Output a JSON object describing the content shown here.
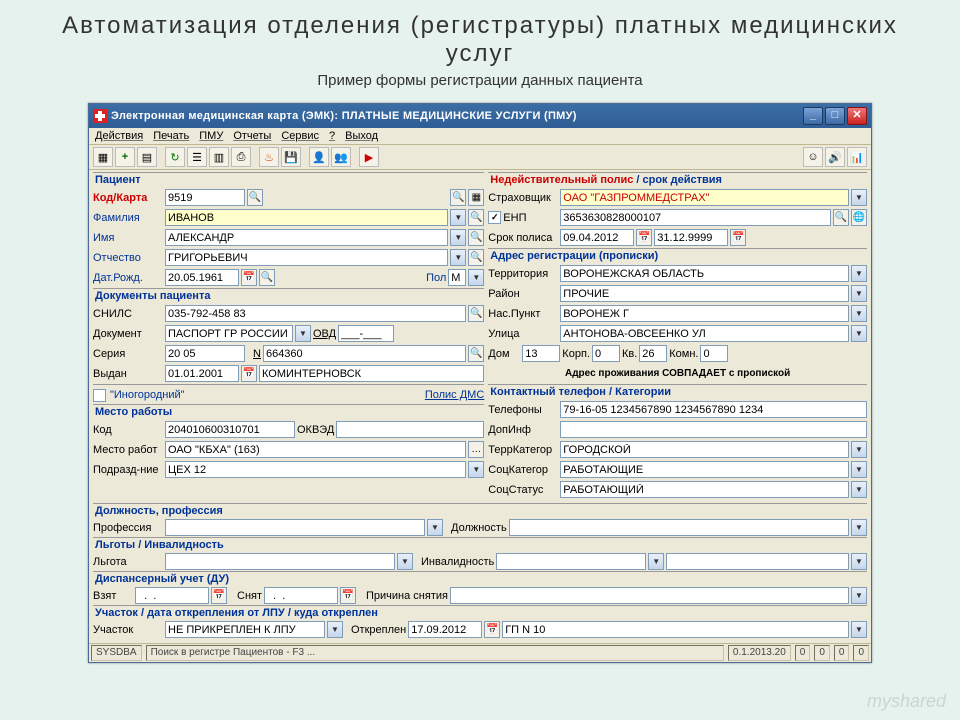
{
  "slide": {
    "title": "Автоматизация   отделения  (регистратуры)  платных медицинских  услуг",
    "subtitle": "Пример формы регистрации данных пациента"
  },
  "titlebar": "Электронная медицинская карта (ЭМК): ПЛАТНЫЕ МЕДИЦИНСКИЕ УСЛУГИ (ПМУ)",
  "menubar": [
    "Действия",
    "Печать",
    "ПМУ",
    "Отчеты",
    "Сервис",
    "?",
    "Выход"
  ],
  "patient": {
    "section": "Пациент",
    "kod_karta_lbl": "Код/Карта",
    "kod": "9519",
    "fam_lbl": "Фамилия",
    "fam": "ИВАНОВ",
    "name_lbl": "Имя",
    "name": "АЛЕКСАНДР",
    "otch_lbl": "Отчество",
    "otch": "ГРИГОРЬЕВИЧ",
    "dob_lbl": "Дат.Рожд.",
    "dob": "20.05.1961",
    "pol_lbl": "Пол",
    "pol": "М"
  },
  "docs": {
    "section": "Документы пациента",
    "snils_lbl": "СНИЛС",
    "snils": "035-792-458 83",
    "doc_lbl": "Документ",
    "doc": "ПАСПОРТ ГР РОССИИ",
    "ovd_lbl": "ОВД",
    "ovd": "___-___",
    "seria_lbl": "Серия",
    "seria": "20 05",
    "n_lbl": "N",
    "num": "664360",
    "vydan_lbl": "Выдан",
    "vydan_date": "01.01.2001",
    "vydan_who": "КОМИНТЕРНОВСК"
  },
  "inogorod": {
    "chk_label": "\"Иногородний\"",
    "polis_dms": "Полис ДМС"
  },
  "work": {
    "section": "Место работы",
    "kod_lbl": "Код",
    "kod": "204010600310701",
    "okved_lbl": "ОКВЭД",
    "mesto_lbl": "Место работ",
    "mesto": "ОАО \"КБХА\" (163)",
    "podr_lbl": "Подразд-ние",
    "podr": "ЦЕХ 12"
  },
  "prof": {
    "section": "Должность, профессия",
    "prof_lbl": "Профессия",
    "dolzh_lbl": "Должность"
  },
  "lgoty": {
    "section": "Льготы / Инвалидность",
    "lgota_lbl": "Льгота",
    "inval_lbl": "Инвалидность"
  },
  "disp": {
    "section": "Диспансерный учет (ДУ)",
    "vzyat_lbl": "Взят",
    "vzyat": "  .  .",
    "snyat_lbl": "Снят",
    "snyat": "  .  .",
    "prich_lbl": "Причина снятия"
  },
  "uchastok": {
    "section": "Участок / дата открепления от ЛПУ / куда откреплен",
    "uch_lbl": "Участок",
    "uch": "НЕ ПРИКРЕПЛЕН К ЛПУ",
    "otkr_lbl": "Откреплен",
    "otkr_date": "17.09.2012",
    "lpu": "ГП N 10"
  },
  "polis": {
    "section_red": "Недействительный полис",
    "section_suffix": " / срок действия",
    "strah_lbl": "Страховщик",
    "strah": "ОАО \"ГАЗПРОММЕДСТРАХ\"",
    "enp_lbl": "ЕНП",
    "enp": "3653630828000107",
    "srok_lbl": "Срок полиса",
    "srok_from": "09.04.2012",
    "srok_to": "31.12.9999"
  },
  "addr": {
    "section": "Адрес регистрации (прописки)",
    "terr_lbl": "Территория",
    "terr": "ВОРОНЕЖСКАЯ ОБЛАСТЬ",
    "raion_lbl": "Район",
    "raion": "ПРОЧИЕ",
    "nas_lbl": "Нас.Пункт",
    "nas": "ВОРОНЕЖ Г",
    "ulica_lbl": "Улица",
    "ulica": "АНТОНОВА-ОВСЕЕНКО УЛ",
    "dom_lbl": "Дом",
    "dom": "13",
    "korp_lbl": "Корп.",
    "korp": "0",
    "kv_lbl": "Кв.",
    "kv": "26",
    "komn_lbl": "Комн.",
    "komn": "0",
    "match": "Адрес проживания СОВПАДАЕТ с пропиской"
  },
  "contact": {
    "section": "Контактный телефон / Категории",
    "tel_lbl": "Телефоны",
    "tel": "79-16-05 1234567890 1234567890 1234",
    "dop_lbl": "ДопИнф",
    "terrkat_lbl": "ТеррКатегор",
    "terrkat": "ГОРОДСКОЙ",
    "sockat_lbl": "СоцКатегор",
    "sockat": "РАБОТАЮЩИЕ",
    "socstat_lbl": "СоцСтатус",
    "socstat": "РАБОТАЮЩИЙ"
  },
  "statusbar": {
    "user": "SYSDBA",
    "hint": "Поиск в регистре Пациентов - F3 ...",
    "ver": "0.1.2013.20",
    "n1": "0",
    "n2": "0",
    "n3": "0",
    "n4": "0"
  },
  "watermark": "myshared"
}
